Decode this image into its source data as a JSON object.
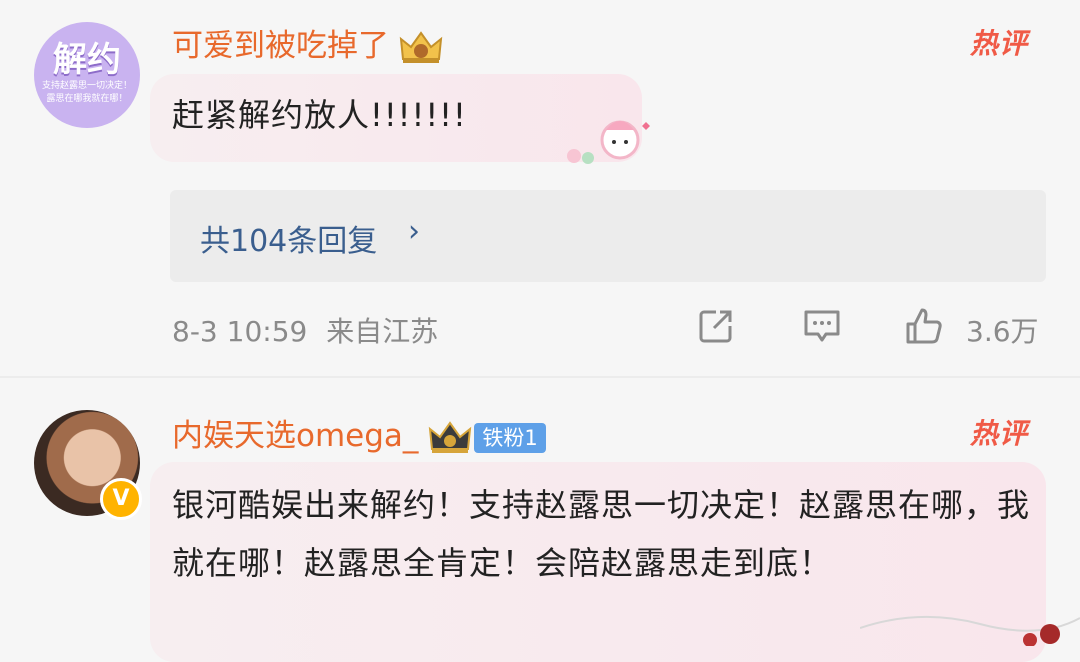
{
  "comments": [
    {
      "avatar_text": "解约",
      "avatar_sub": "支持赵露思一切决定！露思在哪我就在哪！",
      "username": "可爱到被吃掉了",
      "badge_icon": "crown-icon",
      "hot_label": "热评",
      "text": "赶紧解约放人!!!!!!!",
      "replies_label": "共104条回复",
      "timestamp": "8-3 10:59",
      "location": "来自江苏",
      "likes": "3.6万"
    },
    {
      "avatar_badge": "V",
      "username": "内娱天选omega_",
      "badge_icon": "crown-icon",
      "fan_badge": "铁粉1",
      "hot_label": "热评",
      "text": "银河酷娱出来解约！支持赵露思一切决定！赵露思在哪，我就在哪！赵露思全肯定！会陪赵露思走到底！"
    }
  ],
  "colors": {
    "username": "#e8692c",
    "hot": "#f05a46",
    "link": "#3a5e8e",
    "meta": "#8a8a8a"
  }
}
